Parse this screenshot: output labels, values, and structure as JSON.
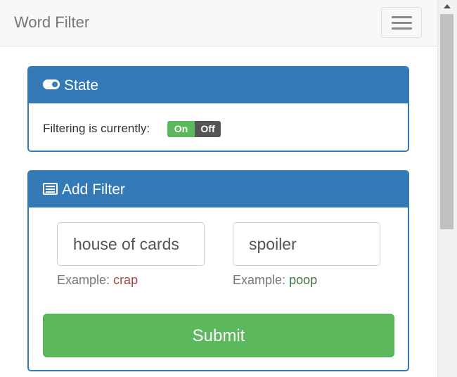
{
  "navbar": {
    "brand": "Word Filter",
    "menu_icon": "hamburger-menu-icon"
  },
  "state_panel": {
    "icon": "toggle-on-icon",
    "title": "State",
    "label": "Filtering is currently:",
    "switch_on": "On",
    "switch_off": "Off",
    "active": "On"
  },
  "add_filter_panel": {
    "icon": "list-alt-icon",
    "title": "Add Filter",
    "word_input_value": "house of cards",
    "replacement_input_value": "spoiler",
    "word_hint_prefix": "Example:",
    "word_hint_example": "crap",
    "replacement_hint_prefix": "Example:",
    "replacement_hint_example": "poop",
    "submit_label": "Submit"
  },
  "colors": {
    "primary": "#337ab7",
    "success": "#5cb85c",
    "off": "#555555",
    "danger_text": "#a94442",
    "success_text": "#3c763d"
  }
}
